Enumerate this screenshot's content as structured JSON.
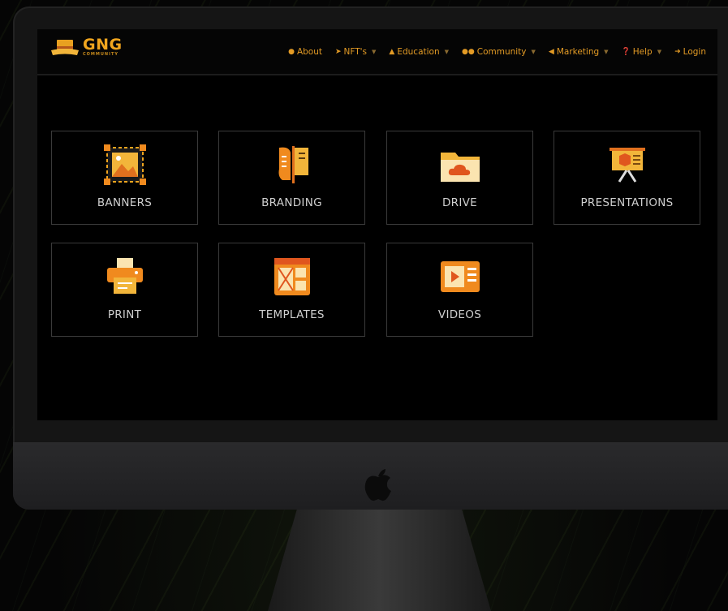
{
  "brand": {
    "name": "GNG",
    "sub": "COMMUNITY"
  },
  "nav": [
    {
      "label": "About",
      "icon": "map-pin-icon",
      "dropdown": false
    },
    {
      "label": "NFT's",
      "icon": "rocket-icon",
      "dropdown": true
    },
    {
      "label": "Education",
      "icon": "graduation-cap-icon",
      "dropdown": true
    },
    {
      "label": "Community",
      "icon": "users-icon",
      "dropdown": true
    },
    {
      "label": "Marketing",
      "icon": "megaphone-icon",
      "dropdown": true
    },
    {
      "label": "Help",
      "icon": "question-circle-icon",
      "dropdown": true
    },
    {
      "label": "Login",
      "icon": "login-icon",
      "dropdown": false
    }
  ],
  "tiles": [
    {
      "label": "BANNERS",
      "icon": "banner-image-icon"
    },
    {
      "label": "BRANDING",
      "icon": "branding-flags-icon"
    },
    {
      "label": "DRIVE",
      "icon": "cloud-folder-icon"
    },
    {
      "label": "PRESENTATIONS",
      "icon": "presentation-board-icon"
    },
    {
      "label": "PRINT",
      "icon": "printer-icon"
    },
    {
      "label": "TEMPLATES",
      "icon": "template-layout-icon"
    },
    {
      "label": "VIDEOS",
      "icon": "video-player-icon"
    }
  ],
  "colors": {
    "accent": "#f0a51e",
    "accent_dark": "#d7621a",
    "tile_border": "#3a3a3a",
    "label": "#cfcfcf"
  }
}
